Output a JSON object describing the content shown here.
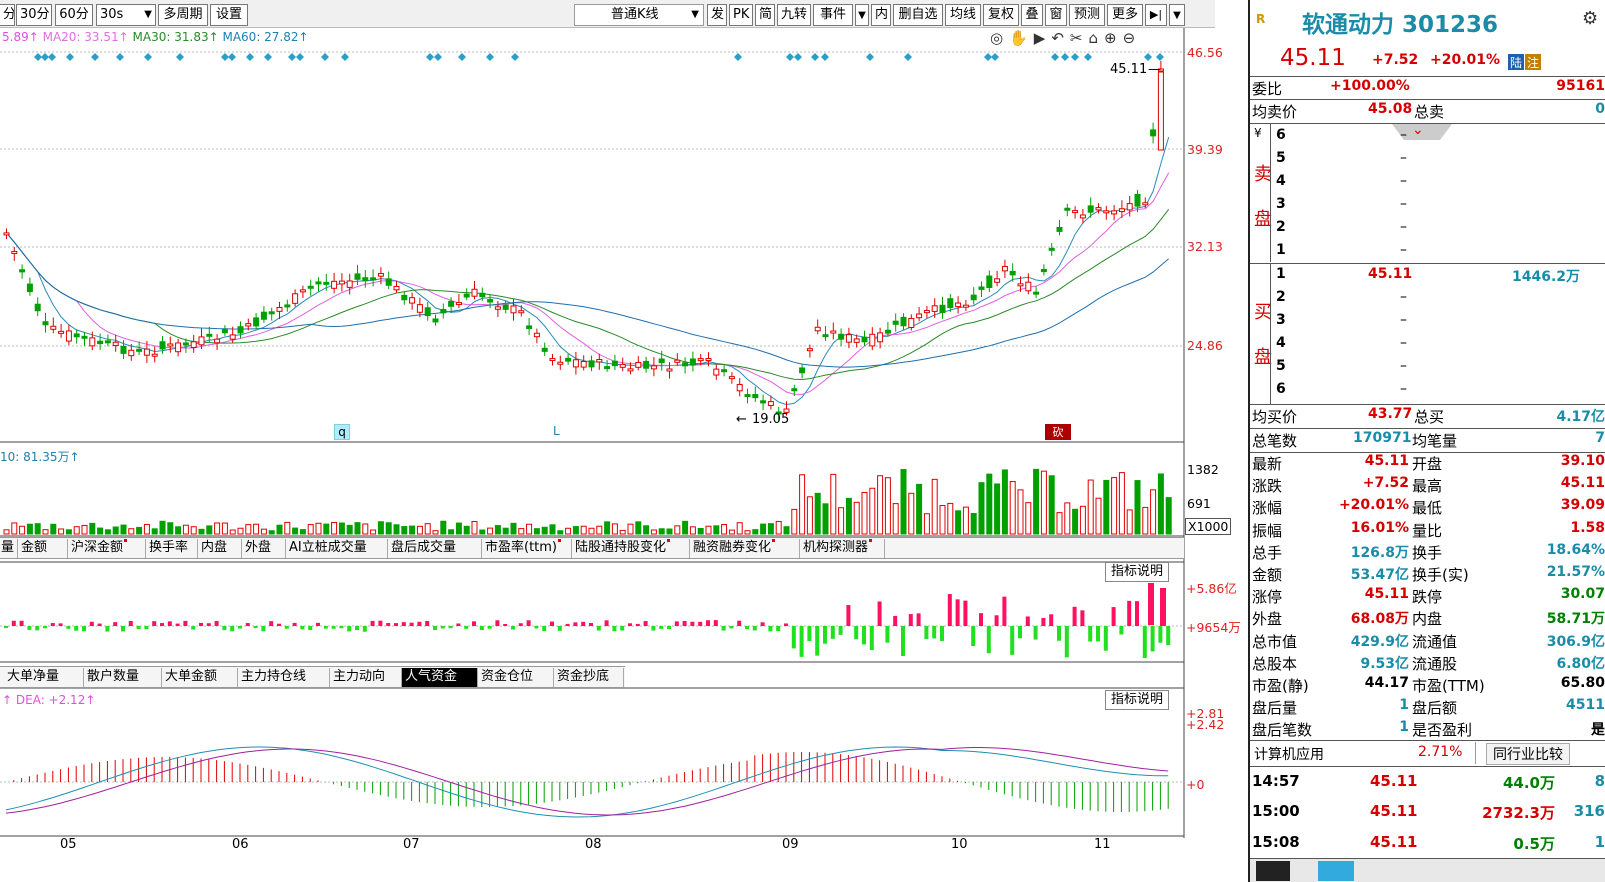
{
  "toolbar": {
    "period_30": "30分",
    "period_60": "60分",
    "period_30s": "30s",
    "multi_period": "多周期",
    "settings": "设置",
    "chart_type": "普通K线",
    "fa": "发",
    "pk": "PK",
    "jian": "简",
    "jiuzhuan": "九转",
    "events": "事件",
    "nei": "内",
    "delete_self": "删自选",
    "avg_line": "均线",
    "fuquan": "复权",
    "die": "叠",
    "chuang": "窗",
    "forecast": "预测",
    "more": "更多",
    "prefix_fen": "分"
  },
  "ma_legend": {
    "ma10": "5.89↑",
    "ma20": "MA20: 33.51↑",
    "ma30": "MA30: 31.83↑",
    "ma60": "MA60: 27.82↑"
  },
  "price_axis": [
    "46.56",
    "39.39",
    "32.13",
    "24.86"
  ],
  "labels": {
    "high_label": "45.11",
    "low_label": "19.05",
    "marker_q": "q",
    "marker_l": "L",
    "badge_kan": "砍"
  },
  "volume": {
    "legend": "10: 81.35万↑",
    "axis": [
      "1382",
      "691"
    ],
    "unit": "X1000"
  },
  "indicator_tabs_1": [
    "量",
    "金额",
    "沪深金额",
    "换手率",
    "内盘",
    "外盘",
    "AI立桩成交量",
    "盘后成交量",
    "市盈率(ttm)",
    "陆股通持股变化",
    "融资融券变化",
    "机构探测器"
  ],
  "indicator_tabs_1_marked": [
    false,
    false,
    true,
    false,
    false,
    false,
    false,
    false,
    true,
    true,
    true,
    true
  ],
  "fund_panel": {
    "axis_top": "+5.86亿",
    "axis_mid": "+9654万",
    "help": "指标说明"
  },
  "indicator_tabs_2": [
    "大单净量",
    "散户数量",
    "大单金额",
    "主力持仓线",
    "主力动向",
    "人气资金",
    "资金仓位",
    "资金抄底"
  ],
  "indicator_tabs_2_selected": 5,
  "macd": {
    "legend_dea": "DEA: +2.12↑",
    "axis_top": "+2.81",
    "axis_mid": "+2.42",
    "axis_zero": "+0",
    "help": "指标说明"
  },
  "date_axis": [
    "05",
    "06",
    "07",
    "08",
    "09",
    "10",
    "11"
  ],
  "stock": {
    "name": "软通动力 301236",
    "price": "45.11",
    "change": "+7.52",
    "change_pct": "+20.01%",
    "tag1": "陆",
    "tag2": "注",
    "r_icon": "R"
  },
  "order_book": {
    "weibi_label": "委比",
    "weibi_value": "+100.00%",
    "weibi_count": "95161",
    "avg_sell_label": "均卖价",
    "avg_sell_value": "45.08",
    "total_sell_label": "总卖",
    "total_sell_value": "0",
    "sell_label_1": "卖",
    "sell_label_2": "盘",
    "buy_label_1": "买",
    "buy_label_2": "盘",
    "yen": "¥",
    "sell_levels": [
      "6",
      "5",
      "4",
      "3",
      "2",
      "1"
    ],
    "sell_prices": [
      "–",
      "–",
      "–",
      "–",
      "–",
      "–"
    ],
    "buy_levels": [
      "1",
      "2",
      "3",
      "4",
      "5",
      "6"
    ],
    "buy_prices": [
      "45.11",
      "–",
      "–",
      "–",
      "–",
      "–"
    ],
    "buy1_volume": "1446.2万",
    "avg_buy_label": "均买价",
    "avg_buy_value": "43.77",
    "total_buy_label": "总买",
    "total_buy_value": "4.17亿",
    "total_trades_label": "总笔数",
    "total_trades_value": "170971",
    "avg_trade_label": "均笔量",
    "avg_trade_value": "7"
  },
  "quote_rows": [
    {
      "l1": "最新",
      "v1": "45.11",
      "c1": "red",
      "l2": "开盘",
      "v2": "39.10",
      "c2": "red"
    },
    {
      "l1": "涨跌",
      "v1": "+7.52",
      "c1": "red",
      "l2": "最高",
      "v2": "45.11",
      "c2": "red"
    },
    {
      "l1": "涨幅",
      "v1": "+20.01%",
      "c1": "red",
      "l2": "最低",
      "v2": "39.09",
      "c2": "red"
    },
    {
      "l1": "振幅",
      "v1": "16.01%",
      "c1": "red",
      "l2": "量比",
      "v2": "1.58",
      "c2": "red"
    },
    {
      "l1": "总手",
      "v1": "126.8万",
      "c1": "teal",
      "l2": "换手",
      "v2": "18.64%",
      "c2": "teal"
    },
    {
      "l1": "金额",
      "v1": "53.47亿",
      "c1": "teal",
      "l2": "换手(实)",
      "v2": "21.57%",
      "c2": "teal"
    },
    {
      "l1": "涨停",
      "v1": "45.11",
      "c1": "red",
      "l2": "跌停",
      "v2": "30.07",
      "c2": "grn"
    },
    {
      "l1": "外盘",
      "v1": "68.08万",
      "c1": "red",
      "l2": "内盘",
      "v2": "58.71万",
      "c2": "grn"
    },
    {
      "l1": "总市值",
      "v1": "429.9亿",
      "c1": "teal",
      "l2": "流通值",
      "v2": "306.9亿",
      "c2": "teal"
    },
    {
      "l1": "总股本",
      "v1": "9.53亿",
      "c1": "teal",
      "l2": "流通股",
      "v2": "6.80亿",
      "c2": "teal"
    },
    {
      "l1": "市盈(静)",
      "v1": "44.17",
      "c1": "blk",
      "l2": "市盈(TTM)",
      "v2": "65.80",
      "c2": "blk"
    },
    {
      "l1": "盘后量",
      "v1": "1",
      "c1": "teal",
      "l2": "盘后额",
      "v2": "4511",
      "c2": "teal"
    },
    {
      "l1": "盘后笔数",
      "v1": "1",
      "c1": "teal",
      "l2": "是否盈利",
      "v2": "是",
      "c2": "blk"
    }
  ],
  "industry": {
    "name": "计算机应用",
    "pct": "2.71%",
    "compare": "同行业比较"
  },
  "ticks": [
    {
      "time": "14:57",
      "price": "45.11",
      "vol": "44.0万",
      "vc": "grn",
      "n": "8"
    },
    {
      "time": "15:00",
      "price": "45.11",
      "vol": "2732.3万",
      "vc": "red",
      "n": "316"
    },
    {
      "time": "15:08",
      "price": "45.11",
      "vol": "0.5万",
      "vc": "grn",
      "n": "1"
    }
  ],
  "colors": {
    "up": "#e00000",
    "down": "#00a000",
    "ma10": "#2a8ab8",
    "ma20": "#e060e0",
    "ma30": "#2a8a2a",
    "ma60": "#1f6fb0"
  }
}
